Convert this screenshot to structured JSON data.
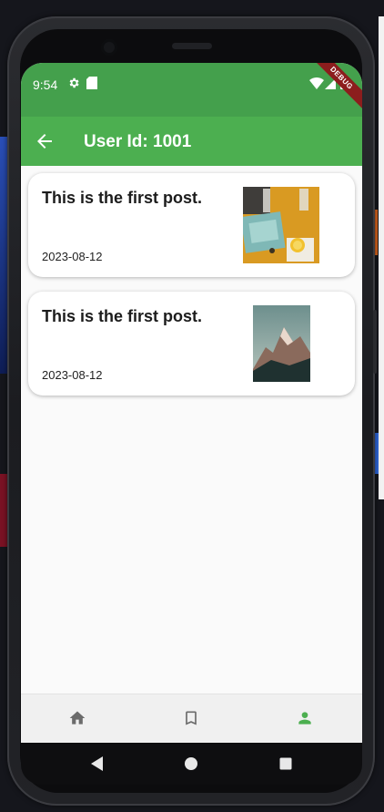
{
  "status_bar": {
    "time": "9:54",
    "debug_label": "DEBUG",
    "background_color": "#44a04c"
  },
  "app_bar": {
    "title": "User Id: 1001",
    "back_icon": "arrow-back-icon",
    "background_color": "#4caf50"
  },
  "posts": [
    {
      "title": "This is the first post.",
      "date": "2023-08-12",
      "image": "table-still-life-photo"
    },
    {
      "title": "This is the first post.",
      "date": "2023-08-12",
      "image": "mountain-peak-photo"
    }
  ],
  "bottom_nav": {
    "items": [
      {
        "icon": "home-icon",
        "selected": false
      },
      {
        "icon": "bookmark-icon",
        "selected": false
      },
      {
        "icon": "person-icon",
        "selected": true
      }
    ],
    "selected_color": "#4caf50",
    "unselected_color": "#6b6b6b"
  },
  "system_nav": [
    "back-triangle-icon",
    "home-circle-icon",
    "recents-square-icon"
  ]
}
